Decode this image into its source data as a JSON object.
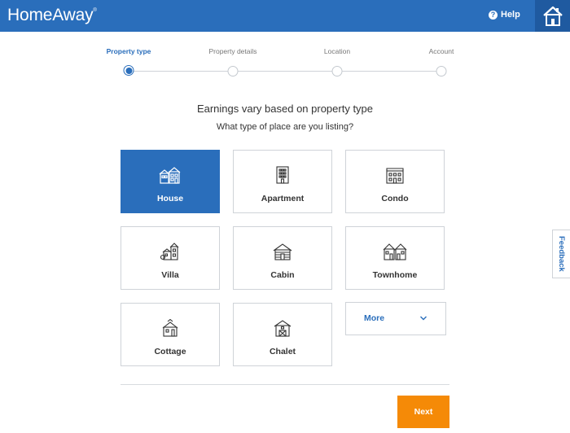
{
  "header": {
    "logo": "HomeAway",
    "logo_mark": "®",
    "help_label": "Help",
    "help_icon": "question-circle-icon",
    "brand_icon": "house-badge-icon",
    "colors": {
      "brand_blue": "#2a6ebb",
      "badge_blue": "#1f5aa0"
    }
  },
  "stepper": {
    "steps": [
      {
        "label": "Property type",
        "active": true
      },
      {
        "label": "Property details",
        "active": false
      },
      {
        "label": "Location",
        "active": false
      },
      {
        "label": "Account",
        "active": false
      }
    ]
  },
  "main": {
    "heading": "Earnings vary based on property type",
    "subheading": "What type of place are you listing?",
    "property_types": [
      {
        "label": "House",
        "icon": "house-icon",
        "selected": true
      },
      {
        "label": "Apartment",
        "icon": "apartment-icon",
        "selected": false
      },
      {
        "label": "Condo",
        "icon": "condo-icon",
        "selected": false
      },
      {
        "label": "Villa",
        "icon": "villa-icon",
        "selected": false
      },
      {
        "label": "Cabin",
        "icon": "cabin-icon",
        "selected": false
      },
      {
        "label": "Townhome",
        "icon": "townhome-icon",
        "selected": false
      },
      {
        "label": "Cottage",
        "icon": "cottage-icon",
        "selected": false
      },
      {
        "label": "Chalet",
        "icon": "chalet-icon",
        "selected": false
      }
    ],
    "more_label": "More",
    "more_icon": "chevron-down-icon",
    "next_label": "Next",
    "next_color": "#f58a07"
  },
  "feedback": {
    "label": "Feedback"
  }
}
